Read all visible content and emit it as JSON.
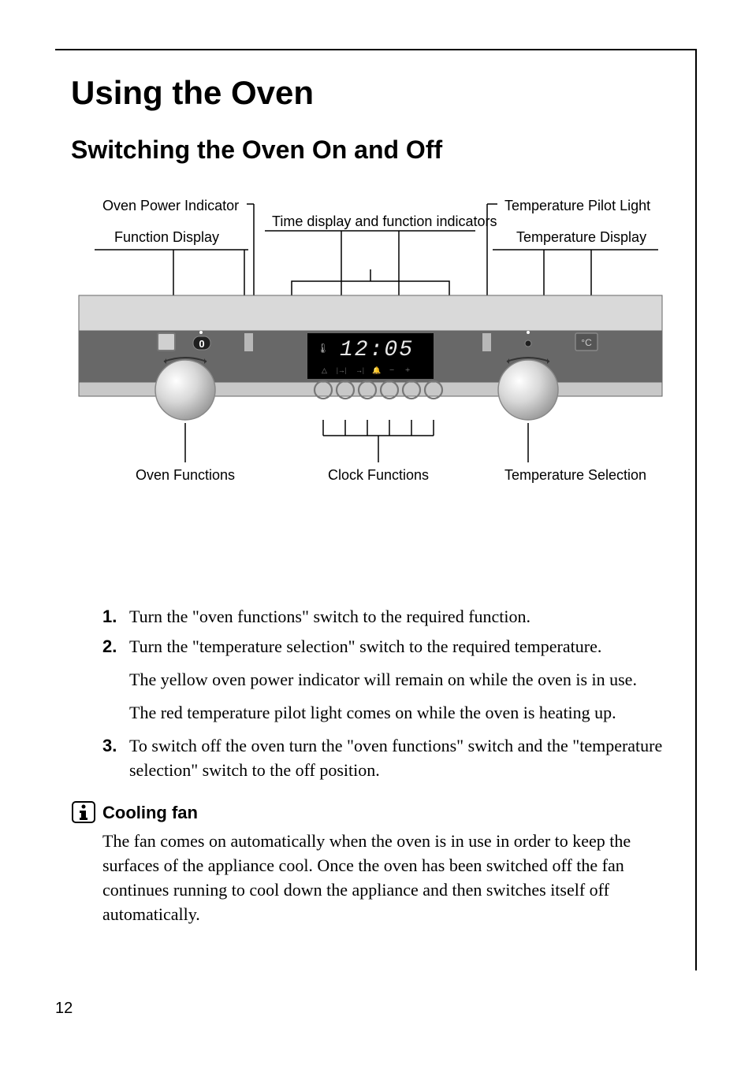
{
  "heading": "Using the Oven",
  "subheading": "Switching the Oven On and Off",
  "diagram": {
    "top_left_1": "Oven Power Indicator",
    "top_left_2": "Function Display",
    "top_center": "Time display and function indicators",
    "top_right_1": "Temperature Pilot Light",
    "top_right_2": "Temperature Display",
    "bottom_left": "Oven Functions",
    "bottom_center": "Clock Functions",
    "bottom_right": "Temperature Selection",
    "time_display": "12:05"
  },
  "steps": [
    {
      "num": "1.",
      "text": "Turn the \"oven functions\" switch to the required function."
    },
    {
      "num": "2.",
      "text": "Turn the \"temperature selection\" switch to the required temperature.",
      "sub": [
        "The yellow oven power indicator will remain on while the oven is in use.",
        "The red temperature pilot light comes on while the oven is heating up."
      ]
    },
    {
      "num": "3.",
      "text": "To switch off the oven turn the \"oven functions\" switch and the \"temperature selection\" switch to the off position."
    }
  ],
  "cooling": {
    "title": "Cooling fan",
    "text": "The fan comes on automatically when the oven is in use in order to keep the surfaces of the appliance cool. Once the oven has been switched off the fan continues running to cool down the appliance and then switches itself off automatically."
  },
  "page_number": "12"
}
